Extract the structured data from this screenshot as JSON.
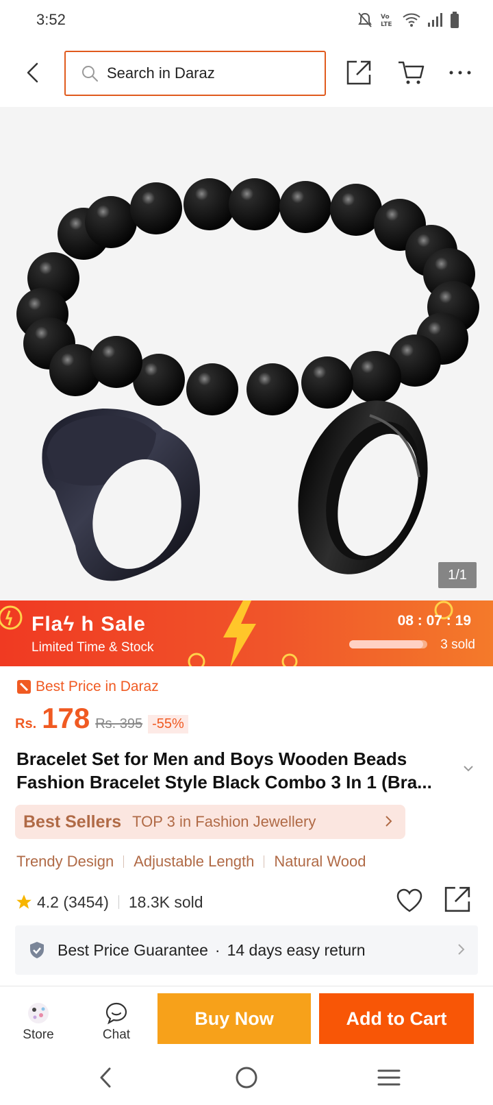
{
  "status_bar": {
    "time": "3:52"
  },
  "header": {
    "search_placeholder": "Search in Daraz"
  },
  "gallery": {
    "counter": "1/1"
  },
  "flash_sale": {
    "title": "Flaϟ h  Sale",
    "subtitle": "Limited Time & Stock",
    "timer": "08 : 07 : 19",
    "sold": "3 sold",
    "sold_progress": 0.95
  },
  "price": {
    "best_price_label": "Best Price in Daraz",
    "currency": "Rs.",
    "current": "178",
    "original": "Rs. 395",
    "discount": "-55%"
  },
  "product": {
    "title": "Bracelet Set for Men and Boys Wooden Beads Fashion Bracelet Style Black Combo 3 In 1 (Bra..."
  },
  "best_sellers": {
    "label": "Best Sellers",
    "text": "TOP 3 in Fashion Jewellery"
  },
  "tags": [
    "Trendy Design",
    "Adjustable Length",
    "Natural Wood"
  ],
  "rating": {
    "score": "4.2 (3454)",
    "sold": "18.3K sold"
  },
  "guarantee": {
    "text1": "Best Price Guarantee",
    "separator": "·",
    "text2": "14 days easy return"
  },
  "action_bar": {
    "store_label": "Store",
    "chat_label": "Chat",
    "buy_now_label": "Buy Now",
    "add_to_cart_label": "Add to Cart"
  },
  "colors": {
    "accent": "#f85606",
    "buy_now": "#f7a11a",
    "best_sellers_text": "#b06a46"
  }
}
